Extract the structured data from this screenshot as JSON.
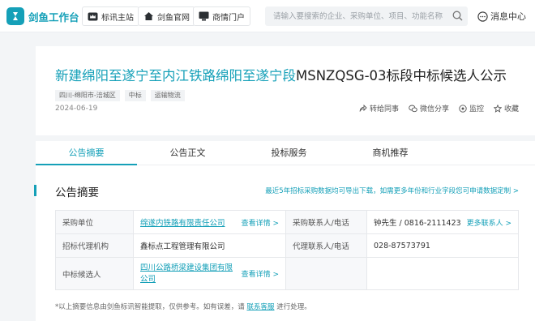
{
  "brand": {
    "name": "剑鱼工作台",
    "color": "#15a0b8"
  },
  "nav": [
    {
      "label": "标讯主站",
      "icon": "crown-icon"
    },
    {
      "label": "剑鱼官网",
      "icon": "home-icon"
    },
    {
      "label": "商情门户",
      "icon": "monitor-icon"
    }
  ],
  "search": {
    "placeholder": "请输入要搜索的企业、采购单位、项目、功能名称"
  },
  "messages": {
    "label": "消息中心"
  },
  "notice": {
    "title_highlight": "新建绵阳至遂宁至内江铁路绵阳至遂宁段",
    "title_rest": "MSNZQSG-03标段中标候选人公示",
    "tags": [
      "四川-绵阳市-涪城区",
      "中标",
      "运输物流"
    ],
    "date": "2024-06-19",
    "actions": [
      {
        "label": "转给同事",
        "icon": "share-icon"
      },
      {
        "label": "微信分享",
        "icon": "wechat-icon"
      },
      {
        "label": "监控",
        "icon": "monitor-eye-icon"
      },
      {
        "label": "收藏",
        "icon": "star-icon"
      }
    ]
  },
  "tabs": [
    "公告摘要",
    "公告正文",
    "投标服务",
    "商机推荐"
  ],
  "summary": {
    "title": "公告摘要",
    "note": "最近5年招标采购数据均可导出下载，如需更多年份和行业字段您可申请数据定制 >",
    "rows": {
      "buyer_label": "采购单位",
      "buyer_value": "绵遂内铁路有限责任公司",
      "buyer_detail": "查看详情 >",
      "buyer_contact_label": "采购联系人/电话",
      "buyer_contact_value": "钟先生 / 0816-2111423",
      "buyer_contact_more": "更多联系人 >",
      "agency_label": "招标代理机构",
      "agency_value": "鑫标点工程管理有限公司",
      "agency_contact_label": "代理联系人/电话",
      "agency_contact_value": "028-87573791",
      "candidate_label": "中标候选人",
      "candidate_value": "四川公路桥梁建设集团有限公司",
      "candidate_detail": "查看详情 >"
    },
    "footnote_pre": "*以上摘要信息由剑鱼标讯智能提取，仅供参考。如有误差，请",
    "footnote_link": "联系客服",
    "footnote_post": "进行处理。"
  }
}
